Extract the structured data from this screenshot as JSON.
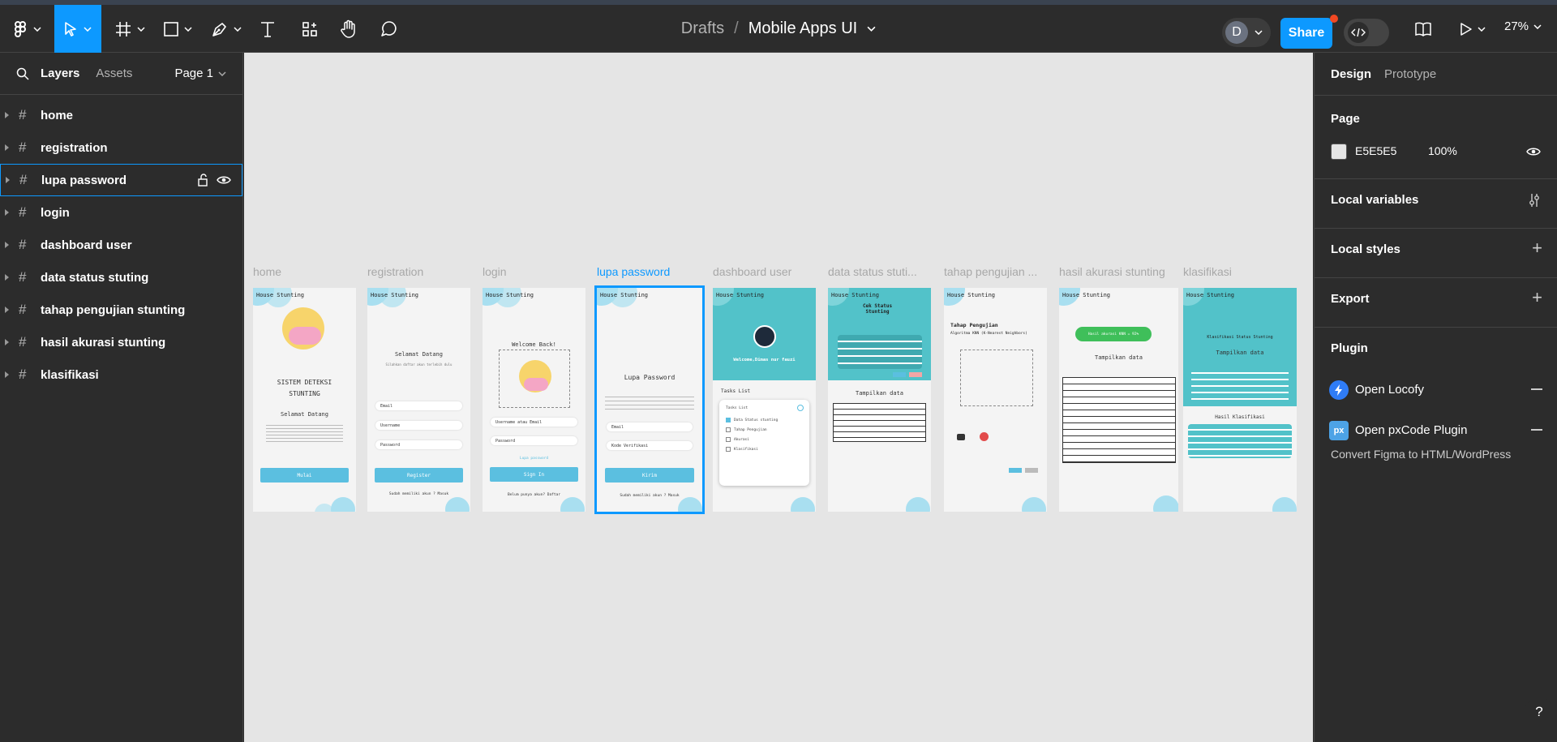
{
  "toolbar": {
    "breadcrumb_parent": "Drafts",
    "breadcrumb_sep": "/",
    "file_name": "Mobile Apps UI",
    "avatar_initial": "D",
    "share_label": "Share",
    "zoom": "27%"
  },
  "left_panel": {
    "tab_layers": "Layers",
    "tab_assets": "Assets",
    "page_label": "Page 1",
    "layers": [
      {
        "name": "home"
      },
      {
        "name": "registration"
      },
      {
        "name": "lupa password"
      },
      {
        "name": "login"
      },
      {
        "name": "dashboard user"
      },
      {
        "name": "data status stuting"
      },
      {
        "name": "tahap pengujian stunting"
      },
      {
        "name": "hasil akurasi stunting"
      },
      {
        "name": "klasifikasi"
      }
    ]
  },
  "canvas": {
    "frame_labels": [
      "home",
      "registration",
      "login",
      "lupa password",
      "dashboard user",
      "data status stuti...",
      "tahap pengujian ...",
      "hasil akurasi stunting",
      "klasifikasi"
    ],
    "brand": "House Stunting",
    "home": {
      "title": "SISTEM DETEKSI STUNTING",
      "welcome": "Selamat Datang",
      "button": "Mulai"
    },
    "registration": {
      "title": "Selamat Datang",
      "subtitle": "Silahkan daftar akun terlebih dulu",
      "field_email": "Email",
      "field_username": "Username",
      "field_password": "Password",
      "button": "Register",
      "footer": "Sudah memiliki akun ? Masuk"
    },
    "login": {
      "title": "Welcome Back!",
      "field_user": "Username atau Email",
      "field_password": "Password",
      "forgot": "Lupa password",
      "button": "Sign In",
      "footer": "Belum punya akun? Daftar"
    },
    "lupa": {
      "title": "Lupa Password",
      "field_email": "Email",
      "field_code": "Kode Verifikasi",
      "button": "Kirim",
      "footer": "Sudah memiliki akun ? Masuk"
    },
    "dashboard": {
      "welcome": "Welcome,Dimas nur fauzi",
      "tasks_title": "Tasks List",
      "card_title": "Tasks List",
      "items": [
        "Data Status stunting",
        "Tahap Pengujian",
        "Akurasi",
        "Klasifikasi"
      ]
    },
    "status": {
      "title": "Cek Status Stunting",
      "table_title": "Tampilkan data"
    },
    "pengujian": {
      "title": "Tahap Pengujian",
      "subtitle": "Algoritma KNN (K-Nearest Neighbors)"
    },
    "akurasi": {
      "badge": "Hasil akurasi KNN = 92%",
      "table_title": "Tampilkan data"
    },
    "klasifikasi": {
      "title": "Klasifikasi Status Stunting",
      "table_title": "Tampilkan data",
      "result_title": "Hasil Klasifikasi"
    }
  },
  "right_panel": {
    "tab_design": "Design",
    "tab_prototype": "Prototype",
    "page_section": "Page",
    "page_color": "E5E5E5",
    "page_color_hex": "#e5e5e5",
    "page_opacity": "100%",
    "local_variables": "Local variables",
    "local_styles": "Local styles",
    "export": "Export",
    "plugin": "Plugin",
    "plugin_1": "Open Locofy",
    "plugin_2": "Open pxCode Plugin",
    "plugin_2_desc": "Convert Figma to HTML/WordPress",
    "plugin_2_icon": "px"
  },
  "help": "?"
}
